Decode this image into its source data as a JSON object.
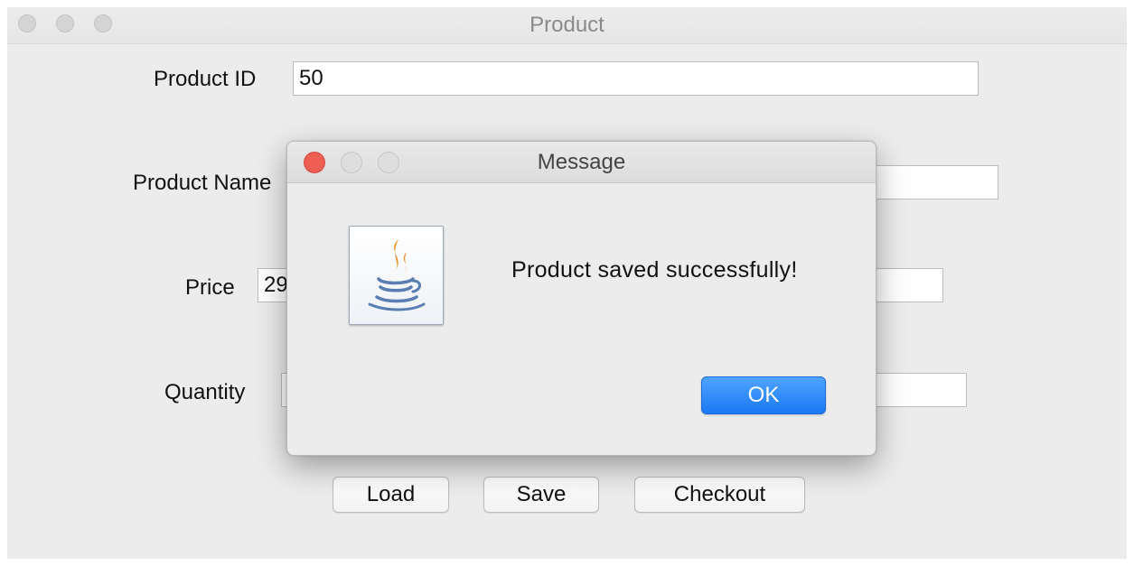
{
  "window": {
    "title": "Product"
  },
  "form": {
    "product_id_label": "Product ID",
    "product_id_value": "50",
    "product_name_label": "Product Name",
    "product_name_value": "",
    "price_label": "Price",
    "price_value": "29",
    "quantity_label": "Quantity",
    "quantity_value": ""
  },
  "buttons": {
    "load": "Load",
    "save": "Save",
    "checkout": "Checkout"
  },
  "dialog": {
    "title": "Message",
    "message": "Product saved successfully!",
    "ok_label": "OK",
    "icon": "java-coffee-cup-icon"
  },
  "colors": {
    "close_light": "#ee5e52",
    "ok_button": "#1a78f2",
    "java_flame": "#e8901f",
    "java_cup": "#5a7db2"
  }
}
